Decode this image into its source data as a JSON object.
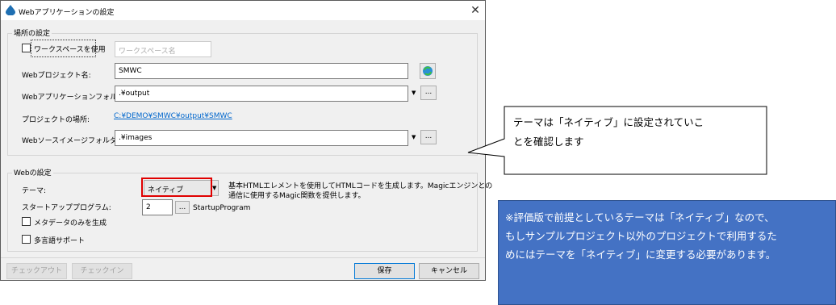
{
  "window": {
    "title": "Webアプリケーションの設定",
    "close": "✕"
  },
  "location_group": {
    "title": "場所の設定",
    "use_workspace_label": "ワークスペースを使用",
    "workspace_placeholder": "ワークスペース名",
    "project_name_label": "Webプロジェクト名:",
    "project_name_value": "SMWC",
    "app_folder_label": "Webアプリケーションフォルダ:",
    "app_folder_value": ".¥output",
    "project_location_label": "プロジェクトの場所:",
    "project_location_value": "C:¥DEMO¥SMWC¥output¥SMWC",
    "image_folder_label": "Webソースイメージフォルダ:",
    "image_folder_value": ".¥images",
    "browse": "..."
  },
  "web_group": {
    "title": "Webの設定",
    "theme_label": "テーマ:",
    "theme_value": "ネイティブ",
    "theme_desc_line1": "基本HTMLエレメントを使用してHTMLコードを生成します。Magicエンジンとの",
    "theme_desc_line2": "通信に使用するMagic関数を提供します。",
    "startup_label": "スタートアッププログラム:",
    "startup_value": "2",
    "startup_name": "StartupProgram",
    "metadata_only_label": "メタデータのみを生成",
    "multilang_label": "多言語サポート",
    "browse": "..."
  },
  "footer": {
    "checkout": "チェックアウト",
    "checkin": "チェックイン",
    "save": "保存",
    "cancel": "キャンセル"
  },
  "callout": {
    "line1": "テーマは「ネイティブ」に設定されていこ",
    "line2": "とを確認します"
  },
  "note": {
    "line1": "※評価版で前提としているテーマは「ネイティブ」なので、",
    "line2": "もしサンプルプロジェクト以外のプロジェクトで利用するた",
    "line3": "めにはテーマを「ネイティブ」に変更する必要があります。"
  },
  "colors": {
    "note_bg": "#4472c4",
    "highlight": "#e00000",
    "link": "#0066cc"
  }
}
